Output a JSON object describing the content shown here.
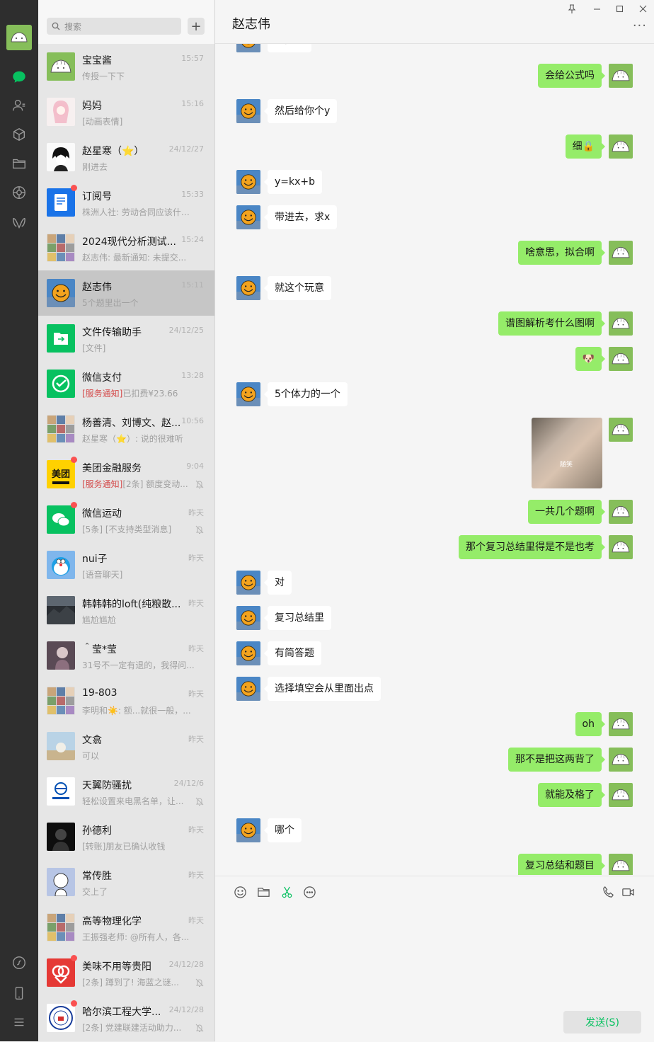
{
  "colors": {
    "accent": "#07c160",
    "bubble_mine": "#95ec69",
    "bubble_theirs": "#ffffff",
    "unread": "#fa5151",
    "nav_bg": "#2e2e2e"
  },
  "nav": {
    "icons": [
      "chat-icon",
      "contacts-icon",
      "favorites-icon",
      "files-icon",
      "moments-icon",
      "channels-icon",
      "mini-programs-icon",
      "phone-icon",
      "menu-icon"
    ]
  },
  "search": {
    "placeholder": "搜索",
    "add_label": "+"
  },
  "conversations": [
    {
      "name": "宝宝酱",
      "time": "15:57",
      "preview": "传授一下下",
      "avatar": "dumpling",
      "unread": false,
      "muted": false
    },
    {
      "name": "妈妈",
      "time": "15:16",
      "preview": "[动画表情]",
      "avatar": "anime-girl",
      "unread": false,
      "muted": false
    },
    {
      "name": "赵星寒（⭐）",
      "time": "24/12/27",
      "preview": "刚进去",
      "avatar": "anime-boy",
      "unread": false,
      "muted": false
    },
    {
      "name": "订阅号",
      "time": "15:33",
      "preview": "株洲人社: 劳动合同应该什么...",
      "avatar": "subscription",
      "unread": true,
      "muted": false
    },
    {
      "name": "2024现代分析测试...",
      "time": "15:24",
      "preview": "赵志伟: 最新通知: 未提交...",
      "avatar": "group-grid",
      "unread": false,
      "muted": false
    },
    {
      "name": "赵志伟",
      "time": "15:11",
      "preview": "5个题里出一个",
      "avatar": "smiley",
      "unread": false,
      "muted": false,
      "active": true
    },
    {
      "name": "文件传输助手",
      "time": "24/12/25",
      "preview": "[文件]",
      "avatar": "file-transfer",
      "unread": false,
      "muted": false
    },
    {
      "name": "微信支付",
      "time": "13:28",
      "preview_tag": "[服务通知]",
      "preview": "已扣费¥23.66",
      "avatar": "wechat-pay",
      "unread": false,
      "muted": false
    },
    {
      "name": "杨善清、刘博文、赵...",
      "time": "10:56",
      "preview": "赵星寒（⭐）: 说的很难听",
      "avatar": "group-grid",
      "unread": false,
      "muted": false
    },
    {
      "name": "美团金融服务",
      "time": "9:04",
      "preview_tag": "[服务通知]",
      "preview": "[2条] 额度变动...",
      "avatar": "meituan",
      "unread": true,
      "muted": true
    },
    {
      "name": "微信运动",
      "time": "昨天",
      "preview": "[5条] [不支持类型消息]",
      "avatar": "wechat-sport",
      "unread": true,
      "muted": true
    },
    {
      "name": "nui子",
      "time": "昨天",
      "preview": "[语音聊天]",
      "avatar": "doraemon",
      "unread": false,
      "muted": false
    },
    {
      "name": "韩韩韩的loft(纯粮散...",
      "time": "昨天",
      "preview": "尴尬尴尬",
      "avatar": "dark-landscape",
      "unread": false,
      "muted": false
    },
    {
      "name": "＾莹*莹",
      "time": "昨天",
      "preview": "31号不一定有退的，我得问...",
      "avatar": "girl-photo",
      "unread": false,
      "muted": false
    },
    {
      "name": "19-803",
      "time": "昨天",
      "preview": "李明和☀️: 额...就很一般，...",
      "avatar": "group-grid",
      "unread": false,
      "muted": false
    },
    {
      "name": "文翕",
      "time": "昨天",
      "preview": "可以",
      "avatar": "sky-photo",
      "unread": false,
      "muted": false
    },
    {
      "name": "天翼防骚扰",
      "time": "24/12/6",
      "preview": "轻松设置来电黑名单，让...",
      "avatar": "telecom",
      "unread": false,
      "muted": true
    },
    {
      "name": "孙德利",
      "time": "昨天",
      "preview": "[转账]朋友已确认收钱",
      "avatar": "dark-portrait",
      "unread": false,
      "muted": false
    },
    {
      "name": "常传胜",
      "time": "昨天",
      "preview": "交上了",
      "avatar": "cartoon-bw",
      "unread": false,
      "muted": false
    },
    {
      "name": "高等物理化学",
      "time": "昨天",
      "preview": "王振强老师: @所有人，各...",
      "avatar": "group-grid",
      "unread": false,
      "muted": false
    },
    {
      "name": "美味不用等贵阳",
      "time": "24/12/28",
      "preview": "[2条] 蹲到了! 海蓝之谜...",
      "avatar": "meiwei",
      "unread": true,
      "muted": true
    },
    {
      "name": "哈尔滨工程大学...",
      "time": "24/12/28",
      "preview": "[2条] 党建联建活动助力...",
      "avatar": "university-seal",
      "unread": true,
      "muted": true
    }
  ],
  "chat": {
    "title": "赵志伟",
    "window_controls": [
      "pin-icon",
      "minimize-icon",
      "maximize-icon",
      "close-icon"
    ],
    "more_label": "···",
    "messages": [
      {
        "side": "left",
        "text": "的曲线"
      },
      {
        "side": "right",
        "text": "会给公式吗"
      },
      {
        "side": "left",
        "text": "然后给你个y"
      },
      {
        "side": "right",
        "text": "细🔒"
      },
      {
        "side": "left",
        "text": "y=kx+b"
      },
      {
        "side": "left",
        "text": "带进去，求x"
      },
      {
        "side": "right",
        "text": "啥意思，拟合啊"
      },
      {
        "side": "left",
        "text": "就这个玩意"
      },
      {
        "side": "right",
        "text": "谱图解析考什么图啊"
      },
      {
        "side": "right",
        "text": "🐶"
      },
      {
        "side": "left",
        "text": "5个体力的一个"
      },
      {
        "side": "right",
        "type": "image",
        "text": "随笑"
      },
      {
        "side": "right",
        "text": "一共几个题啊"
      },
      {
        "side": "right",
        "text": "那个复习总结里得是不是也考"
      },
      {
        "side": "left",
        "text": "对"
      },
      {
        "side": "left",
        "text": "复习总结里"
      },
      {
        "side": "left",
        "text": "有简答题"
      },
      {
        "side": "left",
        "text": "选择填空会从里面出点"
      },
      {
        "side": "right",
        "text": "oh"
      },
      {
        "side": "right",
        "text": "那不是把这两背了"
      },
      {
        "side": "right",
        "text": "就能及格了"
      },
      {
        "side": "left",
        "text": "哪个"
      },
      {
        "side": "right",
        "text": "复习总结和题目"
      }
    ]
  },
  "composer": {
    "tools": [
      "emoji-icon",
      "folder-icon",
      "scissors-icon",
      "chat-history-icon",
      "voice-call-icon",
      "video-call-icon"
    ],
    "send_label": "发送(S)"
  }
}
